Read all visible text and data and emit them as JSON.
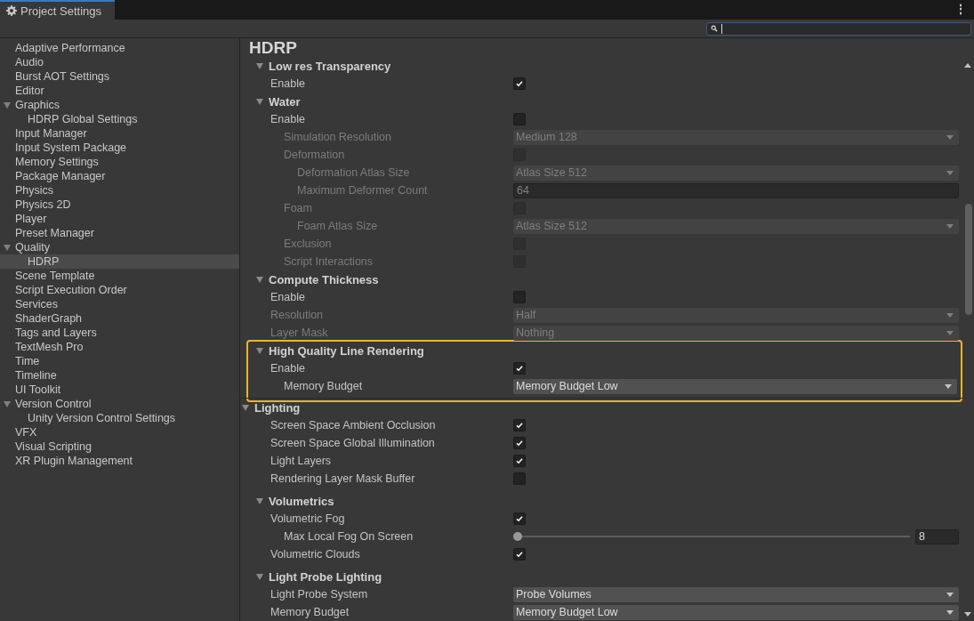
{
  "window": {
    "tab": "Project Settings",
    "menu": "⋮"
  },
  "sidebar": {
    "items": [
      {
        "label": "Adaptive Performance",
        "selected": false
      },
      {
        "label": "Audio",
        "selected": false
      },
      {
        "label": "Burst AOT Settings",
        "selected": false
      },
      {
        "label": "Editor",
        "selected": false
      },
      {
        "label": "Graphics",
        "selected": false,
        "expanded": true,
        "children": [
          {
            "label": "HDRP Global Settings",
            "selected": false
          }
        ]
      },
      {
        "label": "Input Manager",
        "selected": false
      },
      {
        "label": "Input System Package",
        "selected": false
      },
      {
        "label": "Memory Settings",
        "selected": false
      },
      {
        "label": "Package Manager",
        "selected": false
      },
      {
        "label": "Physics",
        "selected": false
      },
      {
        "label": "Physics 2D",
        "selected": false
      },
      {
        "label": "Player",
        "selected": false
      },
      {
        "label": "Preset Manager",
        "selected": false
      },
      {
        "label": "Quality",
        "selected": false,
        "expanded": true,
        "children": [
          {
            "label": "HDRP",
            "selected": true
          }
        ]
      },
      {
        "label": "Scene Template",
        "selected": false
      },
      {
        "label": "Script Execution Order",
        "selected": false
      },
      {
        "label": "Services",
        "selected": false
      },
      {
        "label": "ShaderGraph",
        "selected": false
      },
      {
        "label": "Tags and Layers",
        "selected": false
      },
      {
        "label": "TextMesh Pro",
        "selected": false
      },
      {
        "label": "Time",
        "selected": false
      },
      {
        "label": "Timeline",
        "selected": false
      },
      {
        "label": "UI Toolkit",
        "selected": false
      },
      {
        "label": "Version Control",
        "selected": false,
        "expanded": true,
        "children": [
          {
            "label": "Unity Version Control Settings",
            "selected": false
          }
        ]
      },
      {
        "label": "VFX",
        "selected": false
      },
      {
        "label": "Visual Scripting",
        "selected": false
      },
      {
        "label": "XR Plugin Management",
        "selected": false
      }
    ]
  },
  "inspector": {
    "title": "HDRP",
    "items": [
      {
        "kind": "group",
        "label": "Low res Transparency",
        "expanded": true,
        "highlighted": false,
        "children": [
          {
            "kind": "checkbox",
            "label": "Enable",
            "disabled": false,
            "checked": true
          }
        ]
      },
      {
        "kind": "group",
        "label": "Water",
        "expanded": true,
        "highlighted": false,
        "children": [
          {
            "kind": "checkbox",
            "label": "Enable",
            "disabled": false,
            "checked": false,
            "children": [
              {
                "kind": "dropdown",
                "label": "Simulation Resolution",
                "disabled": true,
                "value": "Medium 128"
              },
              {
                "kind": "checkbox",
                "label": "Deformation",
                "disabled": true,
                "checked": false,
                "children": [
                  {
                    "kind": "dropdown",
                    "label": "Deformation Atlas Size",
                    "disabled": true,
                    "value": "Atlas Size 512"
                  },
                  {
                    "kind": "number",
                    "label": "Maximum Deformer Count",
                    "disabled": true,
                    "value": "64"
                  }
                ]
              },
              {
                "kind": "checkbox",
                "label": "Foam",
                "disabled": true,
                "checked": false,
                "children": [
                  {
                    "kind": "dropdown",
                    "label": "Foam Atlas Size",
                    "disabled": true,
                    "value": "Atlas Size 512"
                  }
                ]
              },
              {
                "kind": "checkbox",
                "label": "Exclusion",
                "disabled": true,
                "checked": false
              },
              {
                "kind": "checkbox",
                "label": "Script Interactions",
                "disabled": true,
                "checked": false
              }
            ]
          }
        ]
      },
      {
        "kind": "group",
        "label": "Compute Thickness",
        "expanded": true,
        "highlighted": false,
        "children": [
          {
            "kind": "checkbox",
            "label": "Enable",
            "disabled": false,
            "checked": false
          },
          {
            "kind": "dropdown",
            "label": "Resolution",
            "disabled": true,
            "value": "Half"
          },
          {
            "kind": "dropdown",
            "label": "Layer Mask",
            "disabled": true,
            "value": "Nothing"
          }
        ]
      },
      {
        "kind": "group",
        "label": "High Quality Line Rendering",
        "expanded": true,
        "highlighted": true,
        "children": [
          {
            "kind": "checkbox",
            "label": "Enable",
            "disabled": false,
            "checked": true,
            "children": [
              {
                "kind": "dropdown",
                "label": "Memory Budget",
                "disabled": false,
                "value": "Memory Budget Low"
              }
            ]
          }
        ]
      },
      {
        "kind": "section",
        "label": "Lighting",
        "expanded": true,
        "highlighted": false,
        "children": [
          {
            "kind": "checkbox",
            "label": "Screen Space Ambient Occlusion",
            "disabled": false,
            "checked": true
          },
          {
            "kind": "checkbox",
            "label": "Screen Space Global Illumination",
            "disabled": false,
            "checked": true
          },
          {
            "kind": "checkbox",
            "label": "Light Layers",
            "disabled": false,
            "checked": true
          },
          {
            "kind": "checkbox",
            "label": "Rendering Layer Mask Buffer",
            "disabled": false,
            "checked": false
          },
          {
            "kind": "group",
            "label": "Volumetrics",
            "expanded": true,
            "highlighted": false,
            "children": [
              {
                "kind": "checkbox",
                "label": "Volumetric Fog",
                "disabled": false,
                "checked": true,
                "children": [
                  {
                    "kind": "slider",
                    "label": "Max Local Fog On Screen",
                    "disabled": false,
                    "level": 0,
                    "value": "8"
                  }
                ]
              },
              {
                "kind": "checkbox",
                "label": "Volumetric Clouds",
                "disabled": false,
                "checked": true
              }
            ]
          },
          {
            "kind": "group",
            "label": "Light Probe Lighting",
            "expanded": true,
            "highlighted": false,
            "children": [
              {
                "kind": "dropdown",
                "label": "Light Probe System",
                "disabled": false,
                "value": "Probe Volumes"
              },
              {
                "kind": "dropdown",
                "label": "Memory Budget",
                "disabled": false,
                "value": "Memory Budget Low"
              }
            ]
          }
        ]
      }
    ]
  }
}
